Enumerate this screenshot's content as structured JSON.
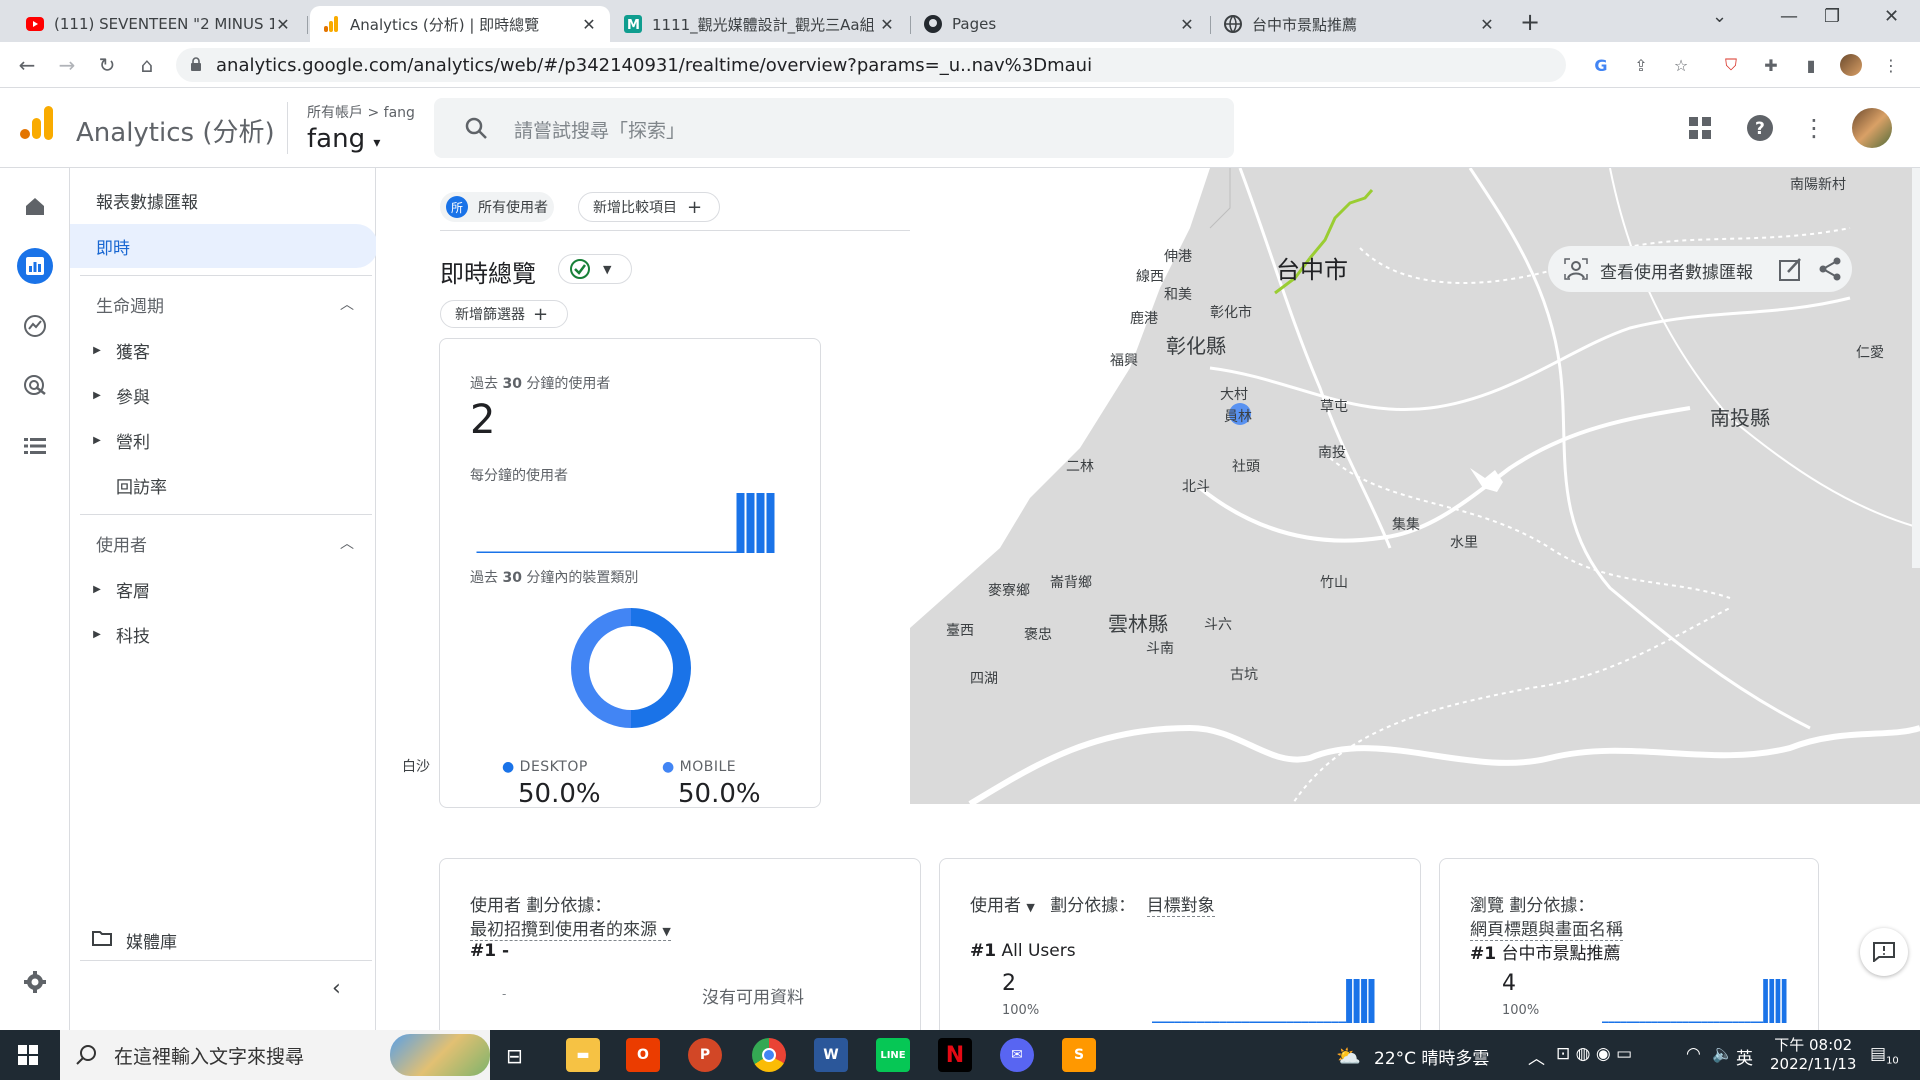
{
  "browser": {
    "tabs": [
      {
        "title": "(111) SEVENTEEN \"2 MINUS 1\"",
        "icon": "youtube-icon",
        "active": false
      },
      {
        "title": "Analytics (分析) | 即時總覽",
        "icon": "analytics-icon",
        "active": true
      },
      {
        "title": "1111_觀光媒體設計_觀光三Aa組",
        "icon": "m-icon",
        "active": false
      },
      {
        "title": "Pages",
        "icon": "github-icon",
        "active": false
      },
      {
        "title": "台中市景點推薦",
        "icon": "globe-icon",
        "active": false
      }
    ],
    "url": "analytics.google.com/analytics/web/#/p342140931/realtime/overview?params=_u..nav%3Dmaui"
  },
  "header": {
    "app_title": "Analytics (分析)",
    "account_path": "所有帳戶",
    "account_sub": "fang",
    "property": "fang",
    "search_placeholder": "請嘗試搜尋「探索」"
  },
  "sidenav": {
    "reports_home": "報表數據匯報",
    "realtime": "即時",
    "lifecycle": "生命週期",
    "lifecycle_items": [
      "獲客",
      "參與",
      "營利"
    ],
    "retention": "回訪率",
    "user": "使用者",
    "user_items": [
      "客層",
      "科技"
    ],
    "library": "媒體庫"
  },
  "toolbar": {
    "avatar_letter": "所",
    "all_users": "所有使用者",
    "add_comparison": "新增比較項目",
    "page_title": "即時總覽",
    "add_filter": "新增篩選器",
    "view_snapshot": "查看使用者數據匯報"
  },
  "summary_card": {
    "users_label_pre": "過去",
    "users_label_num": "30",
    "users_label_post": "分鐘的使用者",
    "users_value": "2",
    "per_minute_label": "每分鐘的使用者",
    "device_label_pre": "過去",
    "device_label_num": "30",
    "device_label_post": "分鐘內的裝置類別",
    "desktop_label": "DESKTOP",
    "desktop_value": "50.0%",
    "mobile_label": "MOBILE",
    "mobile_value": "50.0%"
  },
  "card_source": {
    "metric": "使用者",
    "by": "劃分依據：",
    "dimension": "最初招攬到使用者的來源",
    "rank": "#1",
    "rank_value": "-",
    "empty": "沒有可用資料",
    "dash": "-"
  },
  "card_audience": {
    "metric": "使用者",
    "by": "劃分依據：",
    "dimension": "目標對象",
    "rank": "#1",
    "rank_value": "All Users",
    "value": "2",
    "pct": "100%"
  },
  "card_views": {
    "metric": "瀏覽",
    "by": "劃分依據：",
    "dimension": "網頁標題與畫面名稱",
    "rank": "#1",
    "rank_value": "台中市景點推薦",
    "value": "4",
    "pct": "100%"
  },
  "map_labels": {
    "nanyang": "南陽新村",
    "shengang": "伸港",
    "xianxi": "線西",
    "hemei": "和美",
    "taichung": "台中市",
    "changhua_city": "彰化市",
    "lugang": "鹿港",
    "changhua": "彰化縣",
    "fuxing": "福興",
    "renai": "仁愛",
    "dacun": "大村",
    "yuanlin": "員林",
    "caotun": "草屯",
    "nantou_county": "南投縣",
    "nantou": "南投",
    "erlin": "二林",
    "shetou": "社頭",
    "beidou": "北斗",
    "jiji": "集集",
    "shuili": "水里",
    "zhushan": "竹山",
    "mailiao": "麥寮鄉",
    "lunbei": "崙背鄉",
    "taixi": "臺西",
    "baozhong": "褒忠",
    "yunlin": "雲林縣",
    "douliu": "斗六",
    "dounan": "斗南",
    "gukeng": "古坑",
    "sihu": "四湖",
    "baisha": "白沙"
  },
  "taskbar": {
    "search_placeholder": "在這裡輸入文字來搜尋",
    "weather": "22°C  晴時多雲",
    "ime": "英",
    "time": "下午 08:02",
    "date": "2022/11/13",
    "notif": "10"
  },
  "chart_data": [
    {
      "type": "bar",
      "title": "每分鐘的使用者",
      "x": [
        -30,
        -29,
        -28,
        -27,
        -26,
        -25,
        -24,
        -23,
        -22,
        -21,
        -20,
        -19,
        -18,
        -17,
        -16,
        -15,
        -14,
        -13,
        -12,
        -11,
        -10,
        -9,
        -8,
        -7,
        -6,
        -5,
        -4,
        -3,
        -2,
        -1
      ],
      "values": [
        0,
        0,
        0,
        0,
        0,
        0,
        0,
        0,
        0,
        0,
        0,
        0,
        0,
        0,
        0,
        0,
        0,
        0,
        0,
        0,
        0,
        0,
        0,
        0,
        0,
        0,
        2,
        2,
        2,
        2
      ]
    },
    {
      "type": "pie",
      "title": "過去 30 分鐘內的裝置類別",
      "categories": [
        "DESKTOP",
        "MOBILE"
      ],
      "values": [
        50.0,
        50.0
      ],
      "colors": [
        "#1a73e8",
        "#4285f4"
      ]
    }
  ],
  "colors": {
    "accent": "#1a73e8",
    "bar": "#1a73e8"
  }
}
